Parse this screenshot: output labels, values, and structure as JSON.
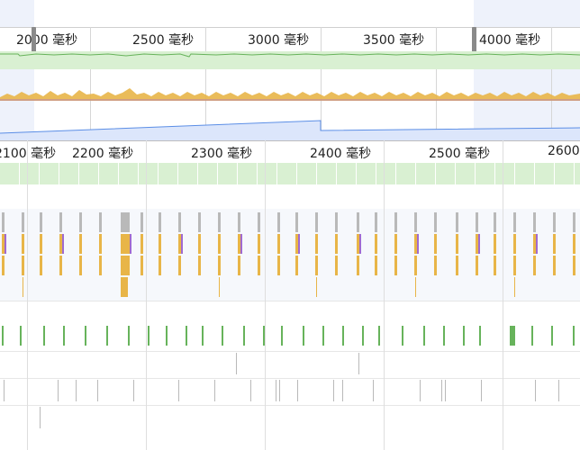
{
  "overview": {
    "ticks": [
      "2000 毫秒",
      "2500 毫秒",
      "3000 毫秒",
      "3500 毫秒",
      "4000 毫秒"
    ],
    "selection": {
      "start_label": "2000 毫秒",
      "end_label": "4000 毫秒"
    }
  },
  "main": {
    "ticks": [
      "2100 毫秒",
      "2200 毫秒",
      "2300 毫秒",
      "2400 毫秒",
      "2500 毫秒",
      "2600"
    ]
  },
  "colors": {
    "fps_band": "#d9f0d2",
    "fps_line": "#67b35b",
    "cpu_yellow": "#e8b548",
    "cpu_purple": "#a06ad0",
    "net_blue": "#5b8ee6",
    "task_gray": "#b9b9b9",
    "selection_dim": "#e8eef9"
  }
}
